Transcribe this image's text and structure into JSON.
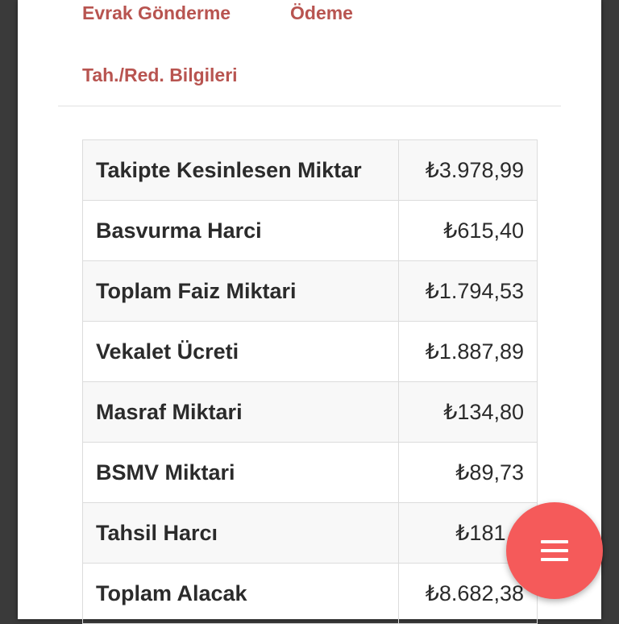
{
  "tabs": [
    {
      "label": "Evrak Gönderme"
    },
    {
      "label": "Ödeme"
    },
    {
      "label": "Tah./Red. Bilgileri"
    }
  ],
  "summary_rows": [
    {
      "label": "Takipte Kesinlesen Miktar",
      "value": "₺3.978,99"
    },
    {
      "label": "Basvurma Harci",
      "value": "₺615,40"
    },
    {
      "label": "Toplam Faiz Miktari",
      "value": "₺1.794,53"
    },
    {
      "label": "Vekalet Ücreti",
      "value": "₺1.887,89"
    },
    {
      "label": "Masraf Miktari",
      "value": "₺134,80"
    },
    {
      "label": "BSMV Miktari",
      "value": "₺89,73"
    },
    {
      "label": "Tahsil Harcı",
      "value": "₺181,0"
    },
    {
      "label": "Toplam Alacak",
      "value": "₺8.682,38"
    }
  ],
  "fab": {
    "icon": "menu-icon",
    "color": "#f55a5a"
  },
  "colors": {
    "accent": "#b85450"
  }
}
